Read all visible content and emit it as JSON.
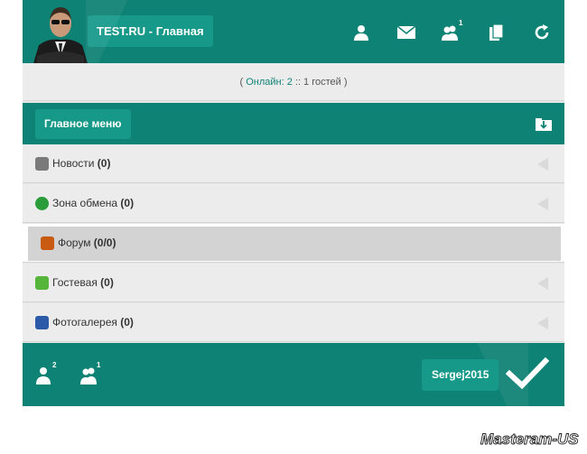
{
  "header": {
    "title": "TEST.RU - Главная",
    "icons": [
      "user-icon",
      "mail-icon",
      "friends-icon",
      "documents-icon",
      "refresh-icon"
    ],
    "friends_badge": "1"
  },
  "online": {
    "open": "( ",
    "link": "Онлайн: 2",
    "rest": " :: 1 гостей )"
  },
  "menu": {
    "label": "Главное меню",
    "items": [
      {
        "label": "Новости",
        "count": "(0)",
        "icon_color": "#7a7a7a"
      },
      {
        "label": "Зона обмена",
        "count": "(0)",
        "icon_color": "#2a9c3a"
      },
      {
        "label": "Форум",
        "count": "(0/0)",
        "icon_color": "#c85a12"
      },
      {
        "label": "Гостевая",
        "count": "(0)",
        "icon_color": "#55b43a"
      },
      {
        "label": "Фотогалерея",
        "count": "(0)",
        "icon_color": "#2a5aa8"
      }
    ]
  },
  "footer": {
    "user_badge": "2",
    "friends_badge": "1",
    "username": "Sergej2015"
  },
  "watermark": "Masteram-US",
  "colors": {
    "accent": "#0e8274",
    "accent_light": "#17998a",
    "background": "#e6e6e6"
  }
}
